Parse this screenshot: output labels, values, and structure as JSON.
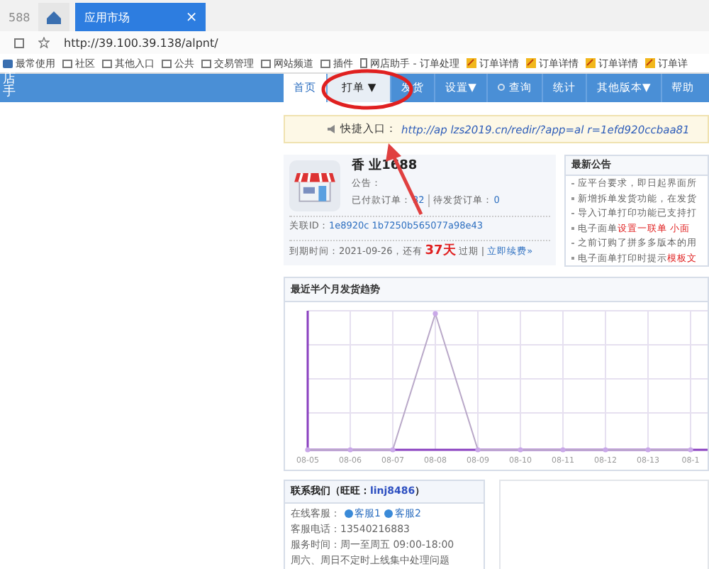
{
  "browser": {
    "tabs": [
      {
        "label": "588",
        "kind": "text",
        "selected": false
      },
      {
        "kind": "home",
        "selected": false
      },
      {
        "label": "应用市场",
        "kind": "text",
        "selected": true,
        "close": "×"
      }
    ],
    "url": "http://39.100.39.138/alpnt/",
    "bookmarks": [
      {
        "label": "最常使用",
        "kind": "star"
      },
      {
        "label": "社区",
        "kind": "folder"
      },
      {
        "label": "其他入口",
        "kind": "folder"
      },
      {
        "label": "公共",
        "kind": "folder"
      },
      {
        "label": "交易管理",
        "kind": "folder"
      },
      {
        "label": "网站频道",
        "kind": "folder"
      },
      {
        "label": "插件",
        "kind": "folder"
      },
      {
        "label": "网店助手 - 订单处理",
        "kind": "page"
      },
      {
        "label": "订单详情",
        "kind": "site"
      },
      {
        "label": "订单详情",
        "kind": "site"
      },
      {
        "label": "订单详情",
        "kind": "site"
      },
      {
        "label": "订单详",
        "kind": "site"
      }
    ]
  },
  "logo": "店手",
  "nav": [
    {
      "label": "首页",
      "selected": true
    },
    {
      "label": "打单 ▼",
      "selected": false,
      "hover": true
    },
    {
      "label": "发货",
      "selected": false
    },
    {
      "label": "设置▼",
      "selected": false
    },
    {
      "label": "查询",
      "selected": false
    },
    {
      "label": "统计",
      "selected": false
    },
    {
      "label": "其他版本▼",
      "selected": false
    },
    {
      "label": "帮助",
      "selected": false
    }
  ],
  "quick_entry": {
    "label": "快捷入口：",
    "url": "http://ap     lzs2019.cn/redir/?app=al     r=1efd920ccbaa81"
  },
  "shop": {
    "name": "香   业1688",
    "notice_label": "公告：",
    "paid_label": "已付款订单：",
    "paid": "32",
    "pending_label": "待发货订单：",
    "pending": "0",
    "id_label": "关联ID：",
    "id": "1e8920c     1b7250b565077a98e43",
    "expiry": "到期时间：2021-09-26，还有",
    "days": "37天",
    "expiry_end": "过期 |",
    "renew": "立即续费»"
  },
  "announcements": {
    "title": "最新公告",
    "items": [
      {
        "text": "应平台要求，即日起界面所"
      },
      {
        "text": "新增拆单发货功能，在发货"
      },
      {
        "text": "导入订单打印功能已支持打"
      },
      {
        "text": "电子面单",
        "highlight": "设置一联单 小面"
      },
      {
        "text": "之前订购了拼多多版本的用"
      },
      {
        "text": "电子面单打印时提示",
        "highlight": "模板文"
      }
    ]
  },
  "trend": {
    "title": "最近半个月发货趋势",
    "x_labels": [
      "08-05",
      "08-06",
      "08-07",
      "08-08",
      "08-09",
      "08-10",
      "08-11",
      "08-12",
      "08-13",
      "08-1"
    ]
  },
  "contact": {
    "title": "联系我们（旺旺：",
    "wangwang": "linj8486",
    "title_end": "）",
    "service_label": "在线客服：",
    "agents": [
      "客服1",
      "客服2"
    ],
    "phone": "客服电话：13540216883",
    "hours": "服务时间：周一至周五 09:00-18:00",
    "weekend": "周六、周日不定时上线集中处理问题"
  }
}
